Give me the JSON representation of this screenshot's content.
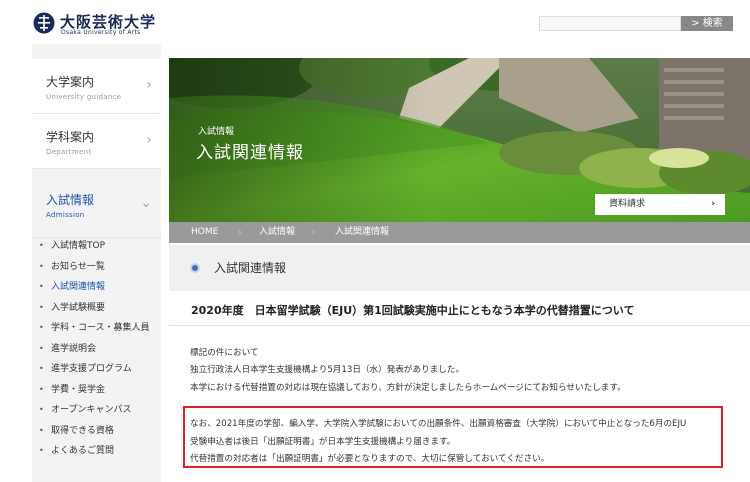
{
  "header": {
    "logo_ja": "大阪芸術大学",
    "logo_en": "Osaka University of Arts",
    "search_button": "> 検索"
  },
  "sidebar": {
    "main_items": [
      {
        "ja": "大学案内",
        "en": "University guidance"
      },
      {
        "ja": "学科案内",
        "en": "Department"
      },
      {
        "ja": "入試情報",
        "en": "Admission"
      }
    ],
    "sub_items": [
      "入試情報TOP",
      "お知らせ一覧",
      "入試関連情報",
      "入学試験概要",
      "学科・コース・募集人員",
      "進学説明会",
      "進学支援プログラム",
      "学費・奨学金",
      "オープンキャンパス",
      "取得できる資格",
      "よくあるご質問"
    ]
  },
  "hero": {
    "subtitle": "入試情報",
    "title": "入試関連情報",
    "doc_request": "資料請求"
  },
  "breadcrumb": [
    "HOME",
    "入試情報",
    "入試関連情報"
  ],
  "page": {
    "title": "入試関連情報",
    "article_title": "2020年度　日本留学試験（EJU）第1回試験実施中止にともなう本学の代替措置について",
    "paragraph1": [
      "標記の件において",
      "独立行政法人日本学生支援機構より5月13日（水）発表がありました。",
      "本学における代替措置の対応は現在協議しており、方針が決定しましたらホームページにてお知らせいたします。"
    ],
    "paragraph2": [
      "なお、2021年度の学部、編入学、大学院入学試験においての出願条件、出願資格審査（大学院）において中止となった6月のEJU",
      "受験申込者は後日「出願証明書」が日本学生支援機構より届きます。",
      "代替措置の対応者は「出願証明書」が必要となりますので、大切に保管しておいてください。"
    ]
  },
  "colors": {
    "accent_blue": "#1d57b0",
    "navy": "#1a2a56",
    "highlight_red": "#e21f26"
  }
}
